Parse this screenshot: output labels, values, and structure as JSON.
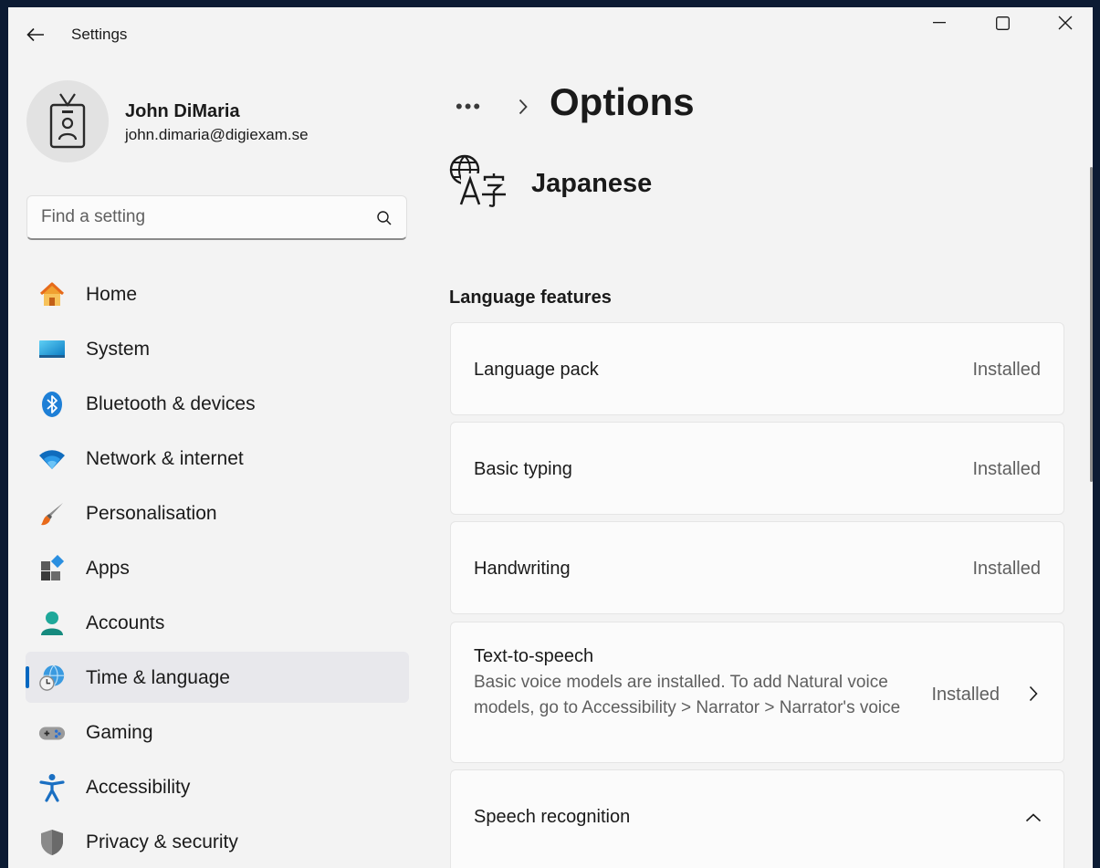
{
  "window": {
    "title": "Settings"
  },
  "profile": {
    "name": "John DiMaria",
    "email": "john.dimaria@digiexam.se"
  },
  "search": {
    "placeholder": "Find a setting"
  },
  "nav": {
    "items": [
      {
        "label": "Home",
        "icon": "home-icon"
      },
      {
        "label": "System",
        "icon": "system-icon"
      },
      {
        "label": "Bluetooth & devices",
        "icon": "bluetooth-icon"
      },
      {
        "label": "Network & internet",
        "icon": "wifi-icon"
      },
      {
        "label": "Personalisation",
        "icon": "brush-icon"
      },
      {
        "label": "Apps",
        "icon": "apps-icon"
      },
      {
        "label": "Accounts",
        "icon": "accounts-icon"
      },
      {
        "label": "Time & language",
        "icon": "time-language-icon",
        "active": true
      },
      {
        "label": "Gaming",
        "icon": "gamepad-icon"
      },
      {
        "label": "Accessibility",
        "icon": "accessibility-icon"
      },
      {
        "label": "Privacy & security",
        "icon": "shield-icon"
      }
    ]
  },
  "breadcrumb": {
    "ellipsis": "•••",
    "current": "Options"
  },
  "language": {
    "name": "Japanese",
    "icon": "language-icon"
  },
  "section": {
    "title": "Language features"
  },
  "features": [
    {
      "title": "Language pack",
      "status": "Installed"
    },
    {
      "title": "Basic typing",
      "status": "Installed"
    },
    {
      "title": "Handwriting",
      "status": "Installed"
    },
    {
      "title": "Text-to-speech",
      "status": "Installed",
      "description": "Basic voice models are installed. To add Natural voice models, go to Accessibility > Narrator > Narrator's voice"
    },
    {
      "title": "Speech recognition"
    }
  ],
  "colors": {
    "accent": "#0067c0",
    "background": "#f3f3f3",
    "card": "#fbfbfb",
    "active_nav": "#e8e8ec"
  }
}
